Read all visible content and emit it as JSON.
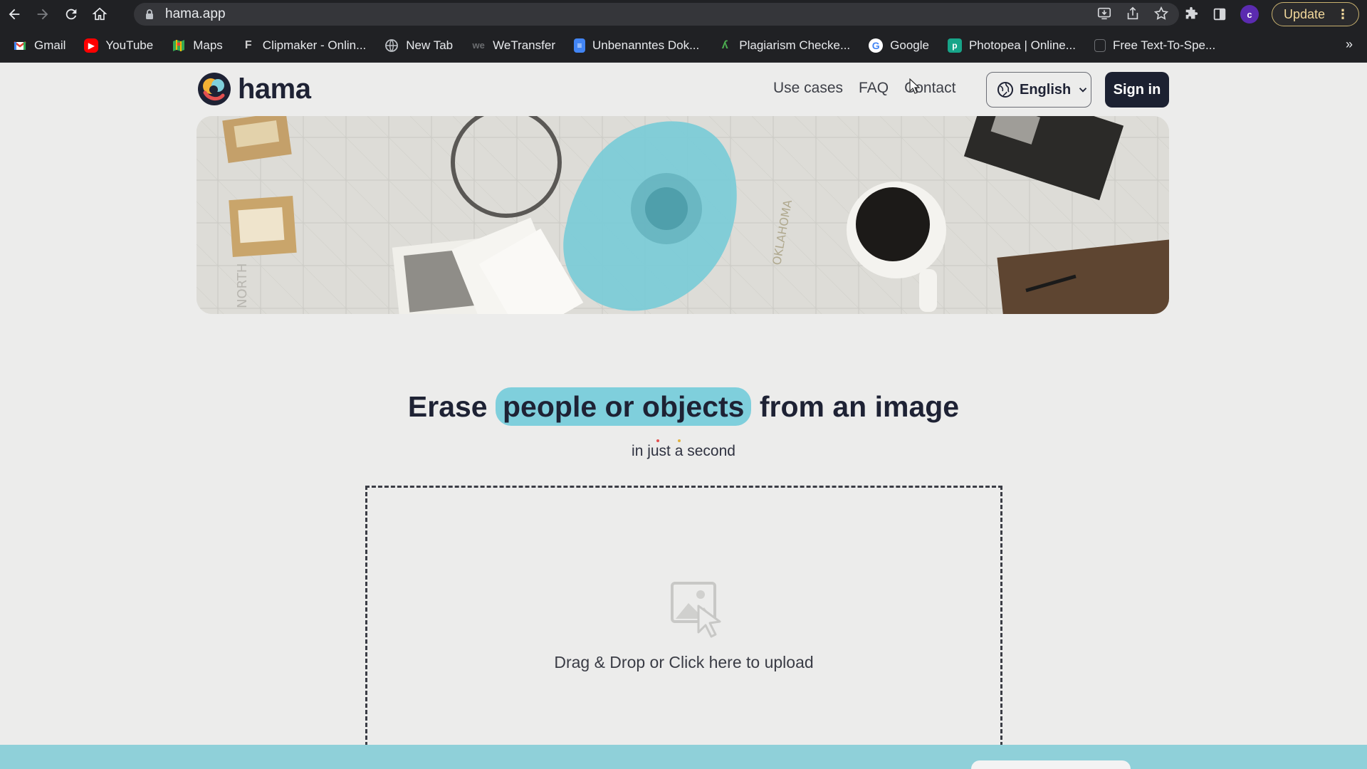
{
  "browser": {
    "url": "hama.app",
    "update_label": "Update",
    "profile_initial": "c",
    "bookmarks": [
      {
        "label": "Gmail",
        "icon": "gmail-icon",
        "color": "#ea4335"
      },
      {
        "label": "YouTube",
        "icon": "youtube-icon",
        "color": "#ff0000"
      },
      {
        "label": "Maps",
        "icon": "maps-icon",
        "color": "#34a853"
      },
      {
        "label": "Clipmaker - Onlin...",
        "icon": "clipmaker-icon",
        "color": "#111111"
      },
      {
        "label": "New Tab",
        "icon": "globe-icon",
        "color": "#5f6368"
      },
      {
        "label": "WeTransfer",
        "icon": "wetransfer-icon",
        "color": "#3a3b3e"
      },
      {
        "label": "Unbenanntes Dok...",
        "icon": "docs-icon",
        "color": "#4285f4"
      },
      {
        "label": "Plagiarism Checke...",
        "icon": "plagiarism-icon",
        "color": "#2e7d32"
      },
      {
        "label": "Google",
        "icon": "google-icon",
        "color": "#ffffff"
      },
      {
        "label": "Photopea | Online...",
        "icon": "photopea-icon",
        "color": "#17a589"
      },
      {
        "label": "Free Text-To-Spe...",
        "icon": "tts-icon",
        "color": "#444444"
      }
    ],
    "more_label": "»"
  },
  "site": {
    "brand": "hama",
    "nav": [
      "Use cases",
      "FAQ",
      "Contact"
    ],
    "language": "English",
    "signin_label": "Sign in",
    "accent": "#7fcfdc"
  },
  "main": {
    "headline_before": "Erase",
    "headline_highlight": "people or objects",
    "headline_after": "from an image",
    "subline": "in just a second",
    "upload_text": "Drag & Drop or Click here to upload"
  }
}
